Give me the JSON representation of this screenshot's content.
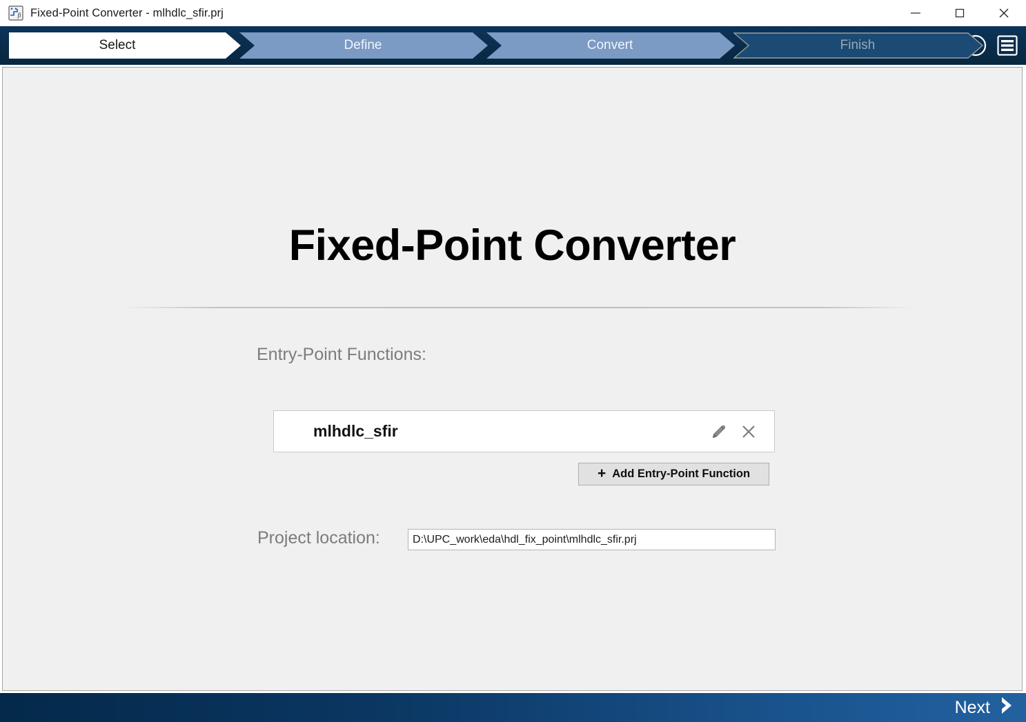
{
  "window": {
    "title": "Fixed-Point Converter - mlhdlc_sfir.prj",
    "app_icon": "fixed-point-converter-icon",
    "controls": {
      "minimize": "minimize-icon",
      "maximize": "maximize-icon",
      "close": "close-icon"
    }
  },
  "wizard": {
    "steps": [
      {
        "label": "Select",
        "state": "active"
      },
      {
        "label": "Define",
        "state": "enabled"
      },
      {
        "label": "Convert",
        "state": "enabled"
      },
      {
        "label": "Finish",
        "state": "disabled"
      }
    ],
    "help_icon": "help-circle-icon",
    "menu_icon": "hamburger-menu-icon"
  },
  "main": {
    "title": "Fixed-Point Converter",
    "entry_point_functions": {
      "label": "Entry-Point Functions:",
      "items": [
        {
          "name": "mlhdlc_sfir",
          "edit_icon": "pencil-icon",
          "remove_icon": "close-x-icon"
        }
      ],
      "add_button": {
        "plus": "+",
        "label": "Add Entry-Point Function"
      }
    },
    "project_location": {
      "label": "Project location:",
      "value": "D:\\UPC_work\\eda\\hdl_fix_point\\mlhdlc_sfir.prj",
      "placeholder": "Project location"
    }
  },
  "footer": {
    "next_label": "Next",
    "next_icon": "chevron-right-icon"
  },
  "colors": {
    "navbar_dark": "#0a2d4d",
    "step_active_bg": "#ffffff",
    "step_enabled_bg": "#7b9ac4",
    "step_disabled_bg": "#1b4a74",
    "content_bg": "#f0f0f0",
    "footer_left": "#04294a",
    "footer_right": "#22619f",
    "label_gray": "#7c7c7c"
  }
}
